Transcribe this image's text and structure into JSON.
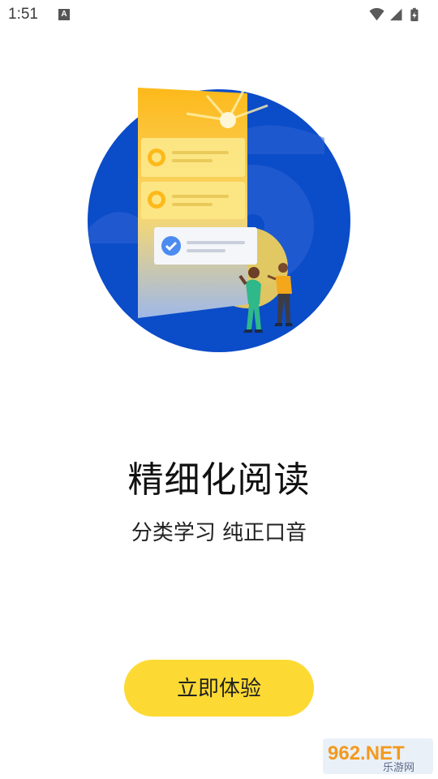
{
  "status_bar": {
    "time": "1:51",
    "notification_icon": "a-notification-icon",
    "icons": [
      "wifi-icon",
      "cell-signal-icon",
      "battery-icon"
    ]
  },
  "onboarding": {
    "title": "精细化阅读",
    "subtitle": "分类学习 纯正口音",
    "cta_label": "立即体验"
  },
  "watermark": {
    "brand": "962.NET",
    "caption": "乐游网"
  },
  "colors": {
    "accent_yellow": "#FDDA33",
    "circle_blue": "#0B4CC8"
  }
}
